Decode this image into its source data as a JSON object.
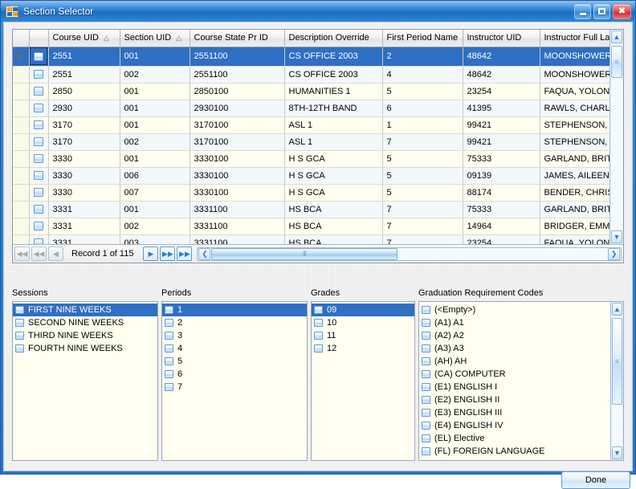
{
  "window": {
    "title": "Section Selector",
    "icon": "app-icon",
    "buttons": {
      "minimize": "minimize-button",
      "maximize": "maximize-button",
      "close": "close-button",
      "close_glyph": "✖"
    }
  },
  "grid": {
    "columns": [
      {
        "key": "rowind",
        "label": ""
      },
      {
        "key": "checkbox",
        "label": ""
      },
      {
        "key": "course_uid",
        "label": "Course UID",
        "sorted": true,
        "sort_glyph": "△"
      },
      {
        "key": "section_uid",
        "label": "Section UID",
        "sorted": true,
        "sort_glyph": "△"
      },
      {
        "key": "course_state_pr_id",
        "label": "Course State Pr ID",
        "sorted": false
      },
      {
        "key": "description_override",
        "label": "Description Override",
        "sorted": false
      },
      {
        "key": "first_period_name",
        "label": "First Period Name",
        "sorted": false
      },
      {
        "key": "instructor_uid",
        "label": "Instructor UID",
        "sorted": false
      },
      {
        "key": "instructor_full_last",
        "label": "Instructor Full Last",
        "sorted": false
      }
    ],
    "current_row_marker": "▶",
    "rows": [
      {
        "course_uid": "2551",
        "section_uid": "001",
        "course_state_pr_id": "2551100",
        "description_override": "CS OFFICE 2003",
        "first_period_name": "2",
        "instructor_uid": "48642",
        "instructor_full_last": "MOONSHOWER, CE",
        "selected": true
      },
      {
        "course_uid": "2551",
        "section_uid": "002",
        "course_state_pr_id": "2551100",
        "description_override": "CS OFFICE 2003",
        "first_period_name": "4",
        "instructor_uid": "48642",
        "instructor_full_last": "MOONSHOWER, CE",
        "selected": false
      },
      {
        "course_uid": "2850",
        "section_uid": "001",
        "course_state_pr_id": "2850100",
        "description_override": "HUMANITIES 1",
        "first_period_name": "5",
        "instructor_uid": "23254",
        "instructor_full_last": "FAQUA, YOLONDA",
        "selected": false
      },
      {
        "course_uid": "2930",
        "section_uid": "001",
        "course_state_pr_id": "2930100",
        "description_override": "8TH-12TH BAND",
        "first_period_name": "6",
        "instructor_uid": "41395",
        "instructor_full_last": "RAWLS, CHARLIE",
        "selected": false
      },
      {
        "course_uid": "3170",
        "section_uid": "001",
        "course_state_pr_id": "3170100",
        "description_override": "ASL 1",
        "first_period_name": "1",
        "instructor_uid": "99421",
        "instructor_full_last": "STEPHENSON, GHIS",
        "selected": false
      },
      {
        "course_uid": "3170",
        "section_uid": "002",
        "course_state_pr_id": "3170100",
        "description_override": "ASL 1",
        "first_period_name": "7",
        "instructor_uid": "99421",
        "instructor_full_last": "STEPHENSON, GHIS",
        "selected": false
      },
      {
        "course_uid": "3330",
        "section_uid": "001",
        "course_state_pr_id": "3330100",
        "description_override": "H S GCA",
        "first_period_name": "5",
        "instructor_uid": "75333",
        "instructor_full_last": "GARLAND, BRITTON",
        "selected": false
      },
      {
        "course_uid": "3330",
        "section_uid": "006",
        "course_state_pr_id": "3330100",
        "description_override": "H S GCA",
        "first_period_name": "5",
        "instructor_uid": "09139",
        "instructor_full_last": "JAMES, AILEEN",
        "selected": false
      },
      {
        "course_uid": "3330",
        "section_uid": "007",
        "course_state_pr_id": "3330100",
        "description_override": "H S GCA",
        "first_period_name": "5",
        "instructor_uid": "88174",
        "instructor_full_last": "BENDER, CHRISTOB",
        "selected": false
      },
      {
        "course_uid": "3331",
        "section_uid": "001",
        "course_state_pr_id": "3331100",
        "description_override": "HS BCA",
        "first_period_name": "7",
        "instructor_uid": "75333",
        "instructor_full_last": "GARLAND, BRITTON",
        "selected": false
      },
      {
        "course_uid": "3331",
        "section_uid": "002",
        "course_state_pr_id": "3331100",
        "description_override": "HS BCA",
        "first_period_name": "7",
        "instructor_uid": "14964",
        "instructor_full_last": "BRIDGER, EMMETT",
        "selected": false
      },
      {
        "course_uid": "3331",
        "section_uid": "003",
        "course_state_pr_id": "3331100",
        "description_override": "HS BCA",
        "first_period_name": "7",
        "instructor_uid": "23254",
        "instructor_full_last": "FAQUA, YOLONDA",
        "selected": false
      }
    ]
  },
  "navigation": {
    "record_label": "Record 1 of 115",
    "first_glyph": "◀◀",
    "prev_page_glyph": "◀◀",
    "prev_glyph": "◀",
    "next_glyph": "▶",
    "next_page_glyph": "▶▶",
    "last_glyph": "▶▶",
    "scroll_left_glyph": "❮",
    "scroll_right_glyph": "❯",
    "thumb_grip": "⦀"
  },
  "scrollbar": {
    "up_glyph": "▲",
    "down_glyph": "▼",
    "grip": "≡"
  },
  "panels": {
    "sessions": {
      "label": "Sessions",
      "items": [
        {
          "label": "FIRST NINE WEEKS",
          "selected": true
        },
        {
          "label": "SECOND NINE WEEKS",
          "selected": false
        },
        {
          "label": "THIRD NINE WEEKS",
          "selected": false
        },
        {
          "label": "FOURTH NINE WEEKS",
          "selected": false
        }
      ]
    },
    "periods": {
      "label": "Periods",
      "items": [
        {
          "label": "1",
          "selected": true
        },
        {
          "label": "2",
          "selected": false
        },
        {
          "label": "3",
          "selected": false
        },
        {
          "label": "4",
          "selected": false
        },
        {
          "label": "5",
          "selected": false
        },
        {
          "label": "6",
          "selected": false
        },
        {
          "label": "7",
          "selected": false
        }
      ]
    },
    "grades": {
      "label": "Grades",
      "items": [
        {
          "label": "09",
          "selected": true
        },
        {
          "label": "10",
          "selected": false
        },
        {
          "label": "11",
          "selected": false
        },
        {
          "label": "12",
          "selected": false
        }
      ]
    },
    "grad_codes": {
      "label": "Graduation Requirement Codes",
      "items": [
        {
          "label": "(<Empty>)",
          "selected": false
        },
        {
          "label": "(A1) A1",
          "selected": false
        },
        {
          "label": "(A2) A2",
          "selected": false
        },
        {
          "label": "(A3) A3",
          "selected": false
        },
        {
          "label": "(AH) AH",
          "selected": false
        },
        {
          "label": "(CA) COMPUTER",
          "selected": false
        },
        {
          "label": "(E1) ENGLISH I",
          "selected": false
        },
        {
          "label": "(E2) ENGLISH II",
          "selected": false
        },
        {
          "label": "(E3) ENGLISH III",
          "selected": false
        },
        {
          "label": "(E4) ENGLISH IV",
          "selected": false
        },
        {
          "label": "(EL) Elective",
          "selected": false
        },
        {
          "label": "(FL) FOREIGN LANGUAGE",
          "selected": false
        }
      ]
    }
  },
  "footer": {
    "done_label": "Done"
  },
  "colors": {
    "selection": "#2f6fc4",
    "title_bar": "#2c81d6",
    "row_alt": "#eef6fb",
    "row_base": "#fffff0",
    "close_button": "#e85555"
  }
}
